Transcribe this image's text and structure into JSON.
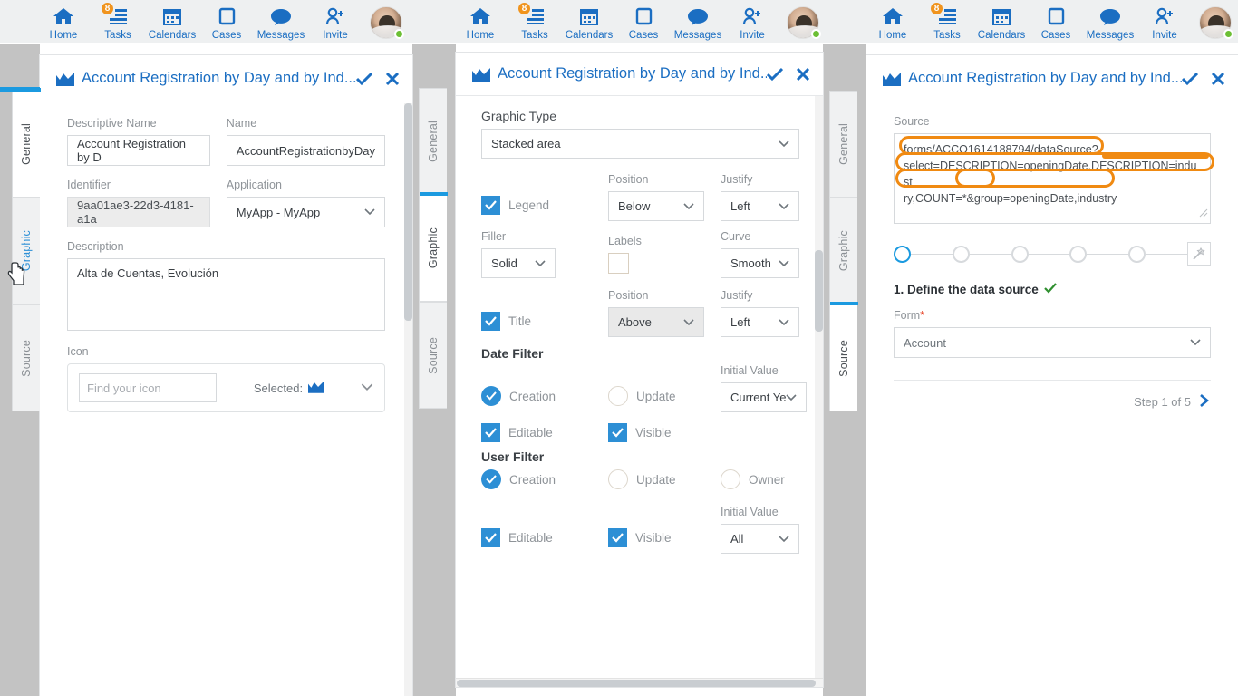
{
  "topnav": {
    "items": [
      {
        "label": "Home",
        "icon": "home-icon",
        "badge": null
      },
      {
        "label": "Tasks",
        "icon": "tasks-icon",
        "badge": "8"
      },
      {
        "label": "Calendars",
        "icon": "calendar-icon",
        "badge": null
      },
      {
        "label": "Cases",
        "icon": "cases-icon",
        "badge": null
      },
      {
        "label": "Messages",
        "icon": "messages-icon",
        "badge": null
      },
      {
        "label": "Invite",
        "icon": "invite-user-icon",
        "badge": null
      }
    ],
    "avatar": {
      "name": "user-avatar",
      "presence": "online"
    }
  },
  "common": {
    "window_title": "Account Registration by Day and by Ind...",
    "accept_icon": "checkmark-icon",
    "close_icon": "close-icon",
    "title_icon": "area-chart-icon",
    "tabs": [
      "General",
      "Graphic",
      "Source"
    ]
  },
  "panel_general": {
    "active_tab": "General",
    "hovered_tab": "Graphic",
    "fields": {
      "descriptive_name_label": "Descriptive Name",
      "descriptive_name_value": "Account Registration by D",
      "name_label": "Name",
      "name_value": "AccountRegistrationbyDay",
      "identifier_label": "Identifier",
      "identifier_value": "9aa01ae3-22d3-4181-a1a",
      "application_label": "Application",
      "application_value": "MyApp - MyApp",
      "description_label": "Description",
      "description_value": "Alta de Cuentas, Evolución",
      "icon_label": "Icon",
      "icon_search_placeholder": "Find your icon",
      "icon_selected_label": "Selected:"
    }
  },
  "panel_graphic": {
    "active_tab": "Graphic",
    "graphic_type_label": "Graphic Type",
    "graphic_type_value": "Stacked area",
    "legend": {
      "checkbox_label": "Legend",
      "checked": true,
      "position_label": "Position",
      "position_value": "Below",
      "justify_label": "Justify",
      "justify_value": "Left"
    },
    "filler": {
      "label": "Filler",
      "value": "Solid"
    },
    "labels": {
      "label": "Labels",
      "checked": false
    },
    "curve": {
      "label": "Curve",
      "value": "Smooth"
    },
    "title": {
      "checkbox_label": "Title",
      "checked": true,
      "position_label": "Position",
      "position_value": "Above",
      "justify_label": "Justify",
      "justify_value": "Left"
    },
    "date_filter": {
      "section_label": "Date Filter",
      "creation_label": "Creation",
      "creation_selected": true,
      "update_label": "Update",
      "update_selected": false,
      "initial_value_label": "Initial Value",
      "initial_value": "Current Ye",
      "editable_label": "Editable",
      "editable_checked": true,
      "visible_label": "Visible",
      "visible_checked": true
    },
    "user_filter": {
      "section_label": "User Filter",
      "creation_label": "Creation",
      "creation_selected": true,
      "update_label": "Update",
      "update_selected": false,
      "owner_label": "Owner",
      "owner_selected": false,
      "initial_value_label": "Initial Value",
      "initial_value": "All",
      "editable_label": "Editable",
      "editable_checked": true,
      "visible_label": "Visible",
      "visible_checked": true
    }
  },
  "panel_source": {
    "active_tab": "Source",
    "source_label": "Source",
    "source_value": "forms/ACCO1614188794/dataSource?select=DESCRIPTION=openingDate,DESCRIPTION=industry,COUNT=*&group=openingDate,industry",
    "source_line1": "forms/ACCO1614188794/dataSource?",
    "source_line2": "select=DESCRIPTION=openingDate,DESCRIPTION=indust",
    "source_line3": "ry,COUNT=*&group=openingDate,industry",
    "wizard": {
      "steps": 5,
      "active_step": 1,
      "wand_icon": "magic-wand-icon"
    },
    "step_heading": "1. Define the data source",
    "step_heading_check": "✔",
    "form_label": "Form",
    "form_required": "*",
    "form_value": "Account",
    "step_nav_text": "Step 1 of 5",
    "step_next_icon": "chevron-right-icon",
    "highlight_color": "#f08a12"
  }
}
